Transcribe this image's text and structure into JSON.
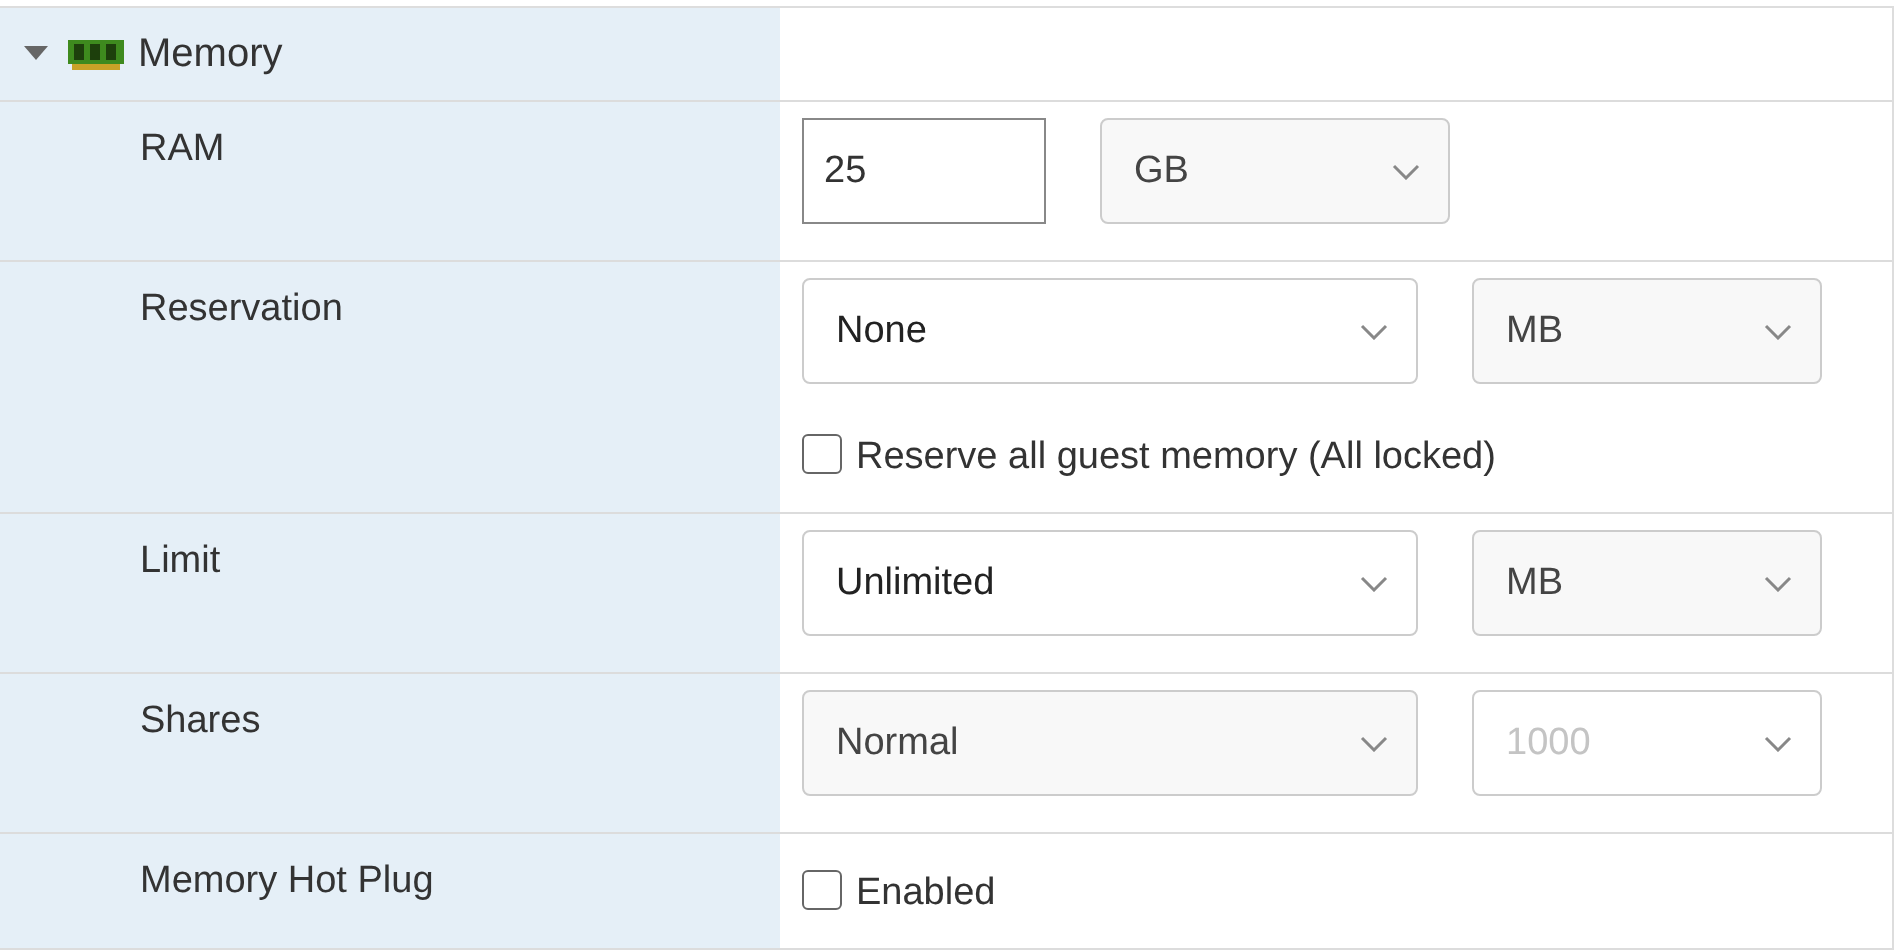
{
  "section": {
    "title": "Memory",
    "expanded": true
  },
  "rows": [
    {
      "label": "RAM",
      "controls": [
        {
          "kind": "input",
          "value": "25"
        },
        {
          "kind": "unitselect",
          "value": "GB",
          "shaded": true,
          "disabled": false
        }
      ]
    },
    {
      "label": "Reservation",
      "controls": [
        {
          "kind": "select",
          "value": "None",
          "shaded": false,
          "disabled": false
        },
        {
          "kind": "unitselect",
          "value": "MB",
          "shaded": true,
          "disabled": false
        },
        {
          "kind": "checkbox",
          "label": "Reserve all guest memory (All locked)",
          "checked": false
        }
      ]
    },
    {
      "label": "Limit",
      "controls": [
        {
          "kind": "select",
          "value": "Unlimited",
          "shaded": false,
          "disabled": false
        },
        {
          "kind": "unitselect",
          "value": "MB",
          "shaded": true,
          "disabled": false
        }
      ]
    },
    {
      "label": "Shares",
      "controls": [
        {
          "kind": "select",
          "value": "Normal",
          "shaded": true,
          "disabled": false
        },
        {
          "kind": "unitselect",
          "value": "1000",
          "shaded": false,
          "disabled": true
        }
      ]
    },
    {
      "label": "Memory Hot Plug",
      "controls": [
        {
          "kind": "checkbox",
          "label": "Enabled",
          "checked": false
        }
      ]
    }
  ]
}
